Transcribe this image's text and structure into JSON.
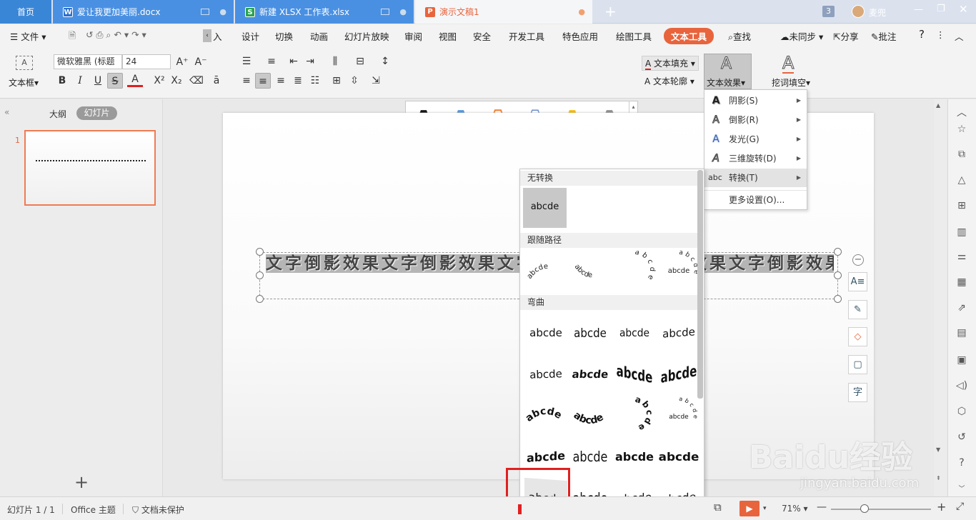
{
  "tabs": {
    "home": "首页",
    "doc1": "爱让我更加美丽.docx",
    "doc2": "新建 XLSX 工作表.xlsx",
    "doc3": "演示文稿1",
    "add": "+",
    "count_badge": "3",
    "user": "麦兜"
  },
  "menu": {
    "file": "文件",
    "items": [
      "入",
      "设计",
      "切换",
      "动画",
      "幻灯片放映",
      "审阅",
      "视图",
      "安全",
      "开发工具",
      "特色应用",
      "绘图工具",
      "文本工具"
    ],
    "find": "查找",
    "unsync": "未同步",
    "share": "分享",
    "comment": "批注",
    "help": "?"
  },
  "ribbon": {
    "textbox_label": "文本框",
    "font_name": "微软雅黑 (标题",
    "font_size": "24",
    "text_fill": "文本填充",
    "text_outline": "文本轮廓",
    "text_effect": "文本效果",
    "cloze": "挖词填空",
    "gallery_letter": "A",
    "gallery_colors": [
      "#000000",
      "#4a90d9",
      "#f08030",
      "#6a8ec8",
      "#f5b800",
      "#888888"
    ]
  },
  "left_panel": {
    "outline_tab": "大纲",
    "slides_tab": "幻灯片",
    "slide_number": "1",
    "add_button": "+"
  },
  "slide": {
    "text": "文字倒影效果文字倒影效果文字倒影效果文字倒影效果文字倒影效果文字倒影效果文字倒影"
  },
  "effect_menu": {
    "items": [
      {
        "label": "阴影(S)",
        "icon": "A"
      },
      {
        "label": "倒影(R)",
        "icon": "A"
      },
      {
        "label": "发光(G)",
        "icon": "A"
      },
      {
        "label": "三维旋转(D)",
        "icon": "A"
      },
      {
        "label": "转换(T)",
        "icon": "abc"
      }
    ],
    "more": "更多设置(O)..."
  },
  "transform_panel": {
    "section_none": "无转换",
    "none_sample": "abcde",
    "section_path": "跟随路径",
    "section_warp": "弯曲",
    "sample": "abcde"
  },
  "status": {
    "slide_info": "幻灯片 1 / 1",
    "theme": "Office 主题",
    "protect": "文档未保护",
    "zoom": "71%"
  },
  "watermark": {
    "brand": "Baidu经验",
    "url": "jingyan.baidu.com"
  },
  "colors": {
    "accent": "#e8643c",
    "tab_blue": "#4a90e2",
    "highlight_red": "#e02020"
  }
}
